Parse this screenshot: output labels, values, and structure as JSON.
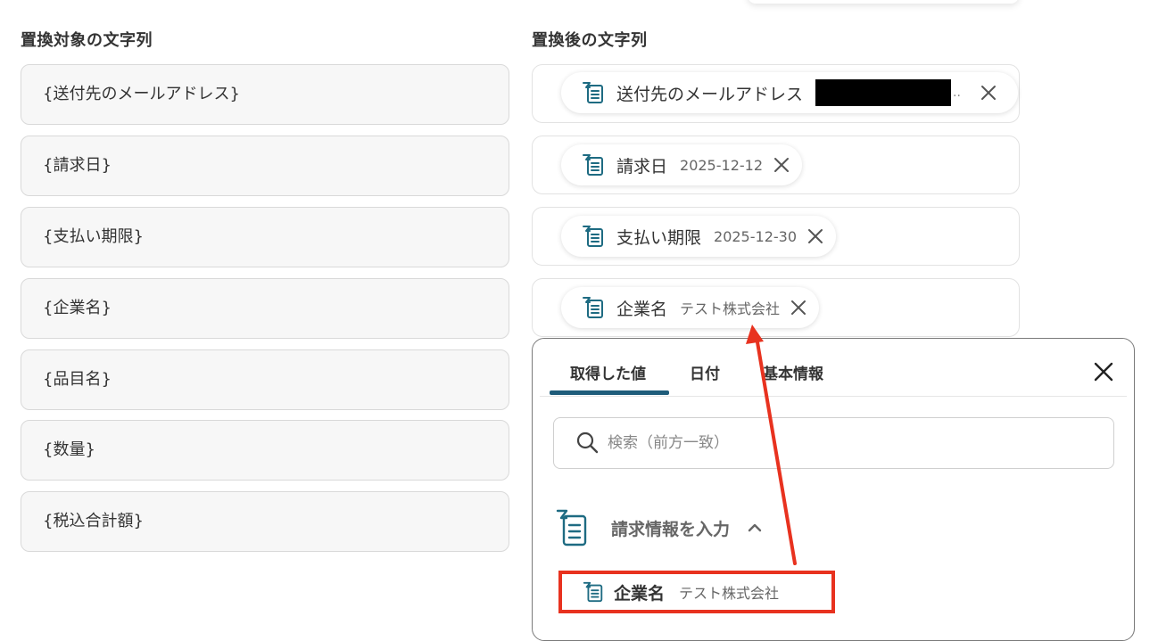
{
  "left_column": {
    "heading": "置換対象の文字列",
    "fields": [
      "{送付先のメールアドレス}",
      "{請求日}",
      "{支払い期限}",
      "{企業名}",
      "{品目名}",
      "{数量}",
      "{税込合計額}"
    ]
  },
  "right_column": {
    "heading": "置換後の文字列",
    "chips": [
      {
        "label": "送付先のメールアドレス",
        "value": "",
        "truncation": "..",
        "redacted": true
      },
      {
        "label": "請求日",
        "value": "2025-12-12"
      },
      {
        "label": "支払い期限",
        "value": "2025-12-30"
      },
      {
        "label": "企業名",
        "value": "テスト株式会社"
      }
    ]
  },
  "dropdown": {
    "tabs": [
      {
        "label": "取得した値",
        "active": true
      },
      {
        "label": "日付",
        "active": false
      },
      {
        "label": "基本情報",
        "active": false
      }
    ],
    "search_placeholder": "検索（前方一致）",
    "group": {
      "label": "請求情報を入力",
      "expanded": true,
      "items": [
        {
          "label": "企業名",
          "value": "テスト株式会社",
          "highlighted": true
        }
      ]
    }
  },
  "icons": {
    "chip": "form-trigger-icon",
    "close": "close-icon",
    "search": "search-icon",
    "chevron": "chevron-up-icon"
  },
  "colors": {
    "accent": "#1e5c7a",
    "icon_teal": "#1e6b82",
    "annotation_red": "#e8321f"
  }
}
